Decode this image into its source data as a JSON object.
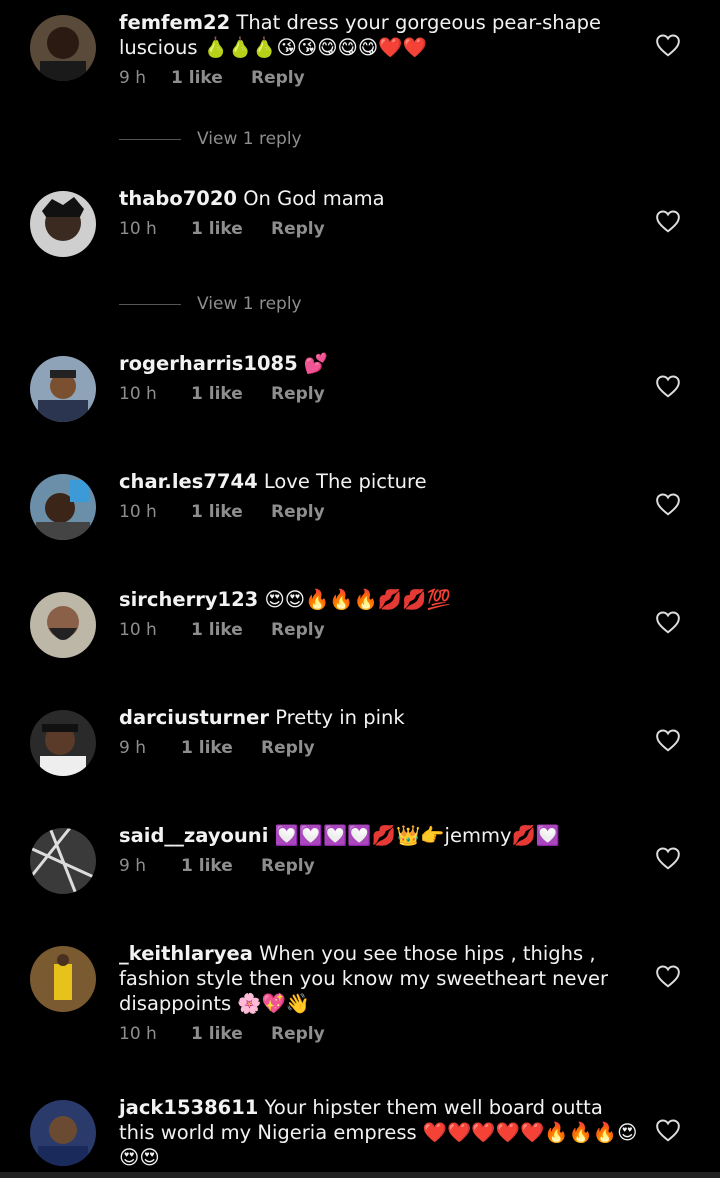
{
  "comments": [
    {
      "user": "femfem22",
      "text": "That dress your gorgeous pear-shape luscious 🍐🍐🍐😘😘😋😋😋❤️❤️",
      "time": "9 h",
      "likes": "1 like",
      "reply": "Reply",
      "view_replies": "View 1 reply"
    },
    {
      "user": "thabo7020",
      "text": "On God mama",
      "time": "10 h",
      "likes": "1 like",
      "reply": "Reply",
      "view_replies": "View 1 reply"
    },
    {
      "user": "rogerharris1085",
      "text": "💕",
      "time": "10 h",
      "likes": "1 like",
      "reply": "Reply"
    },
    {
      "user": "char.les7744",
      "text": "Love The picture",
      "time": "10 h",
      "likes": "1 like",
      "reply": "Reply"
    },
    {
      "user": "sircherry123",
      "text": "😍😍🔥🔥🔥💋💋💯",
      "time": "10 h",
      "likes": "1 like",
      "reply": "Reply"
    },
    {
      "user": "darciusturner",
      "text": "Pretty in pink",
      "time": "9 h",
      "likes": "1 like",
      "reply": "Reply"
    },
    {
      "user": "said__zayouni",
      "text": "💟💟💟💟💋👑👉jemmy💋💟",
      "time": "9 h",
      "likes": "1 like",
      "reply": "Reply"
    },
    {
      "user": "_keithlaryea",
      "text": "When you see those hips , thighs , fashion style then you know my sweetheart never disappoints 🌸💖👋",
      "time": "10 h",
      "likes": "1 like",
      "reply": "Reply"
    },
    {
      "user": "jack1538611",
      "text": "Your hipster them well board outta this world my Nigeria empress ❤️❤️❤️❤️❤️🔥🔥🔥😍😍😍"
    }
  ],
  "colors": {
    "background": "#000000",
    "primary_text": "#f2f2f2",
    "secondary_text": "#8e8e8e"
  },
  "icons": {
    "like": "heart-outline-icon"
  }
}
